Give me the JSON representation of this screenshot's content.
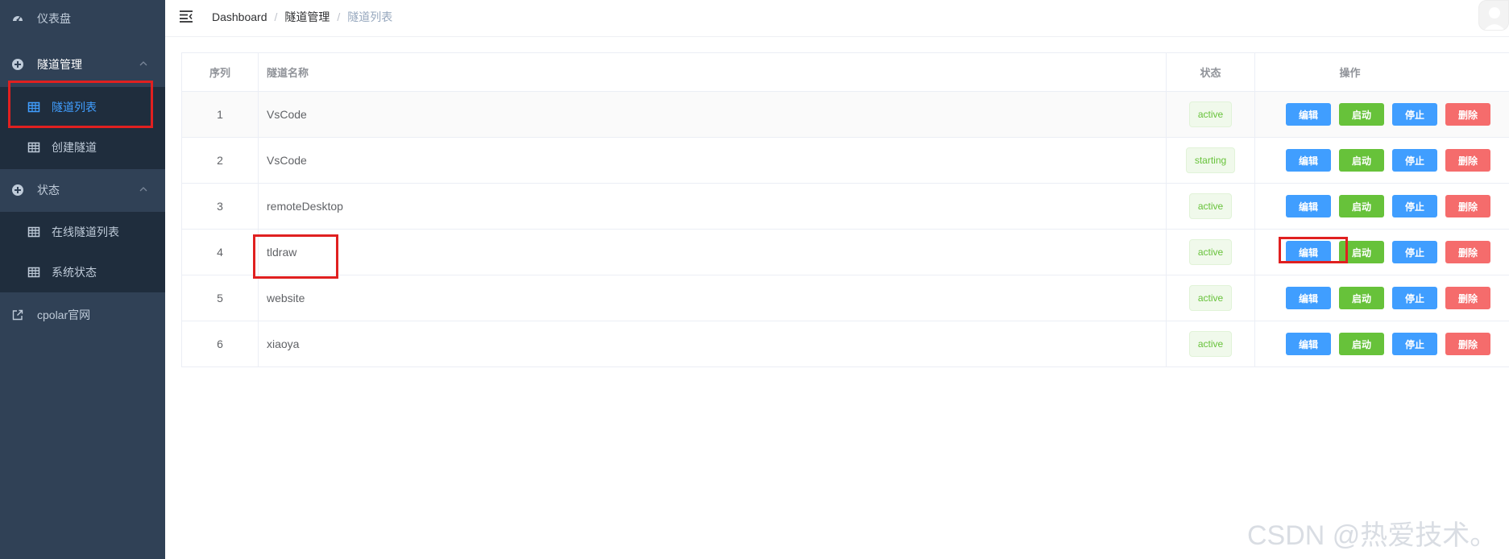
{
  "sidebar": {
    "dashboard": "仪表盘",
    "tunnel_mgmt": "隧道管理",
    "tunnel_list": "隧道列表",
    "create_tunnel": "创建隧道",
    "status": "状态",
    "online_tunnels": "在线隧道列表",
    "system_status": "系统状态",
    "cpolar_site": "cpolar官网"
  },
  "breadcrumb": {
    "home": "Dashboard",
    "sep1": "/",
    "section": "隧道管理",
    "sep2": "/",
    "page": "隧道列表"
  },
  "table": {
    "headers": {
      "index": "序列",
      "name": "隧道名称",
      "status": "状态",
      "ops": "操作"
    },
    "rows": [
      {
        "index": "1",
        "name": "VsCode",
        "status": "active"
      },
      {
        "index": "2",
        "name": "VsCode",
        "status": "starting"
      },
      {
        "index": "3",
        "name": "remoteDesktop",
        "status": "active"
      },
      {
        "index": "4",
        "name": "tldraw",
        "status": "active"
      },
      {
        "index": "5",
        "name": "website",
        "status": "active"
      },
      {
        "index": "6",
        "name": "xiaoya",
        "status": "active"
      }
    ],
    "actions": {
      "edit": "编辑",
      "start": "启动",
      "stop": "停止",
      "delete": "删除"
    }
  },
  "watermark": "CSDN @热爱技术。",
  "colors": {
    "sidebar_bg": "#304156",
    "submenu_bg": "#1f2d3d",
    "accent": "#409eff",
    "success": "#67c23a",
    "danger": "#f56c6c",
    "highlight": "#e02020"
  }
}
